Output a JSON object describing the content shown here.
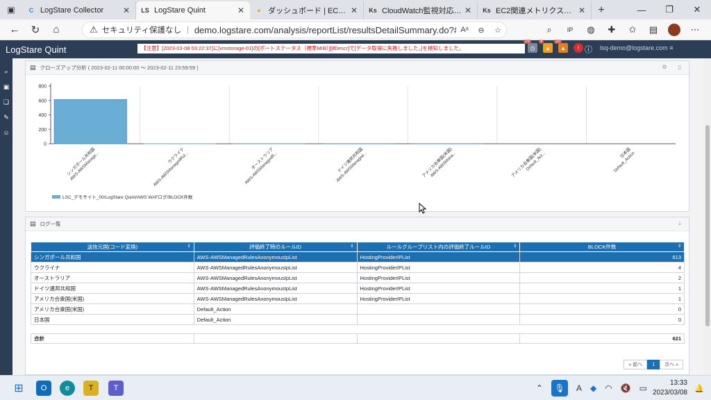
{
  "browser": {
    "tabs": [
      {
        "label": "LogStare Collector",
        "icon": "C",
        "color": "#1e88e5"
      },
      {
        "label": "LogStare Quint",
        "icon": "LS",
        "color": "#333333"
      },
      {
        "label": "ダッシュボード | EC2 Manage",
        "icon": "●",
        "color": "#f5a623"
      },
      {
        "label": "CloudWatch監視対応サービ",
        "icon": "Ks",
        "color": "#333333"
      },
      {
        "label": "EC2関連メトリクス一覧 | セキ",
        "icon": "Ks",
        "color": "#333333"
      }
    ],
    "security_label": "セキュリティ保護なし",
    "url": "demo.logstare.com/analysis/reportList/resultsDetailSummary.do?#4261e7a..."
  },
  "app": {
    "brand": "LogStare Quint",
    "alert": "【注意】[2023-03-08 03:22:37]に[vmstorage-01]の[ポートステータス（標準MIB）][ifDescr]で[データ取得に失敗しました。]を検知しました。",
    "badges": [
      "25",
      "4",
      "20"
    ],
    "user": "lsq-demo@logstare.com"
  },
  "chart_panel": {
    "title": "クローズアップ分析 ( 2023-02-11 00:00:00 ～ 2023-02-11 23:59:59 )"
  },
  "chart_data": {
    "type": "bar",
    "ylim": [
      0,
      800
    ],
    "yticks": [
      0,
      200,
      400,
      600,
      800
    ],
    "categories": [
      [
        "シンガポール共和国",
        "AWS-AWSManage..."
      ],
      [
        "ウクライナ",
        "AWS-AWSManagedRul..."
      ],
      [
        "オーストラリア",
        "AWS-AWSManagedR..."
      ],
      [
        "ドイツ連邦共和国",
        "AWS-AWSManaged..."
      ],
      [
        "アメリカ合衆国(米国)",
        "AWS-AWSMana..."
      ],
      [
        "アメリカ合衆国(米国)",
        "Default_Act..."
      ],
      [
        "日本国",
        "Default_Action"
      ]
    ],
    "series": [
      {
        "name": "LSC_デモサイト_00/LogStare Quint/AWS WAFログ/BLOCK件数",
        "values": [
          613,
          4,
          2,
          1,
          1,
          0,
          0
        ],
        "color": "#6aaed6"
      }
    ]
  },
  "log_panel": {
    "title": "ログ一覧",
    "columns": [
      "送信元国(コード変換)",
      "評価終了時のルールID",
      "ルールグループリスト内の評価終了ルールID",
      "BLOCK件数"
    ],
    "rows": [
      [
        "シンガポール共和国",
        "AWS-AWSManagedRulesAnonymousIpList",
        "HostingProviderIPList",
        "613"
      ],
      [
        "ウクライナ",
        "AWS-AWSManagedRulesAnonymousIpList",
        "HostingProviderIPList",
        "4"
      ],
      [
        "オーストラリア",
        "AWS-AWSManagedRulesAnonymousIpList",
        "HostingProviderIPList",
        "2"
      ],
      [
        "ドイツ連邦共和国",
        "AWS-AWSManagedRulesAnonymousIpList",
        "HostingProviderIPList",
        "1"
      ],
      [
        "アメリカ合衆国(米国)",
        "AWS-AWSManagedRulesAnonymousIpList",
        "HostingProviderIPList",
        "1"
      ],
      [
        "アメリカ合衆国(米国)",
        "Default_Action",
        "",
        "0"
      ],
      [
        "日本国",
        "Default_Action",
        "",
        "0"
      ]
    ],
    "total_label": "合計",
    "total_value": "621",
    "pager": {
      "prev": "« 前へ",
      "page": "1",
      "next": "次へ »"
    }
  },
  "taskbar": {
    "time": "13:33",
    "date": "2023/03/08",
    "ime": "A"
  }
}
